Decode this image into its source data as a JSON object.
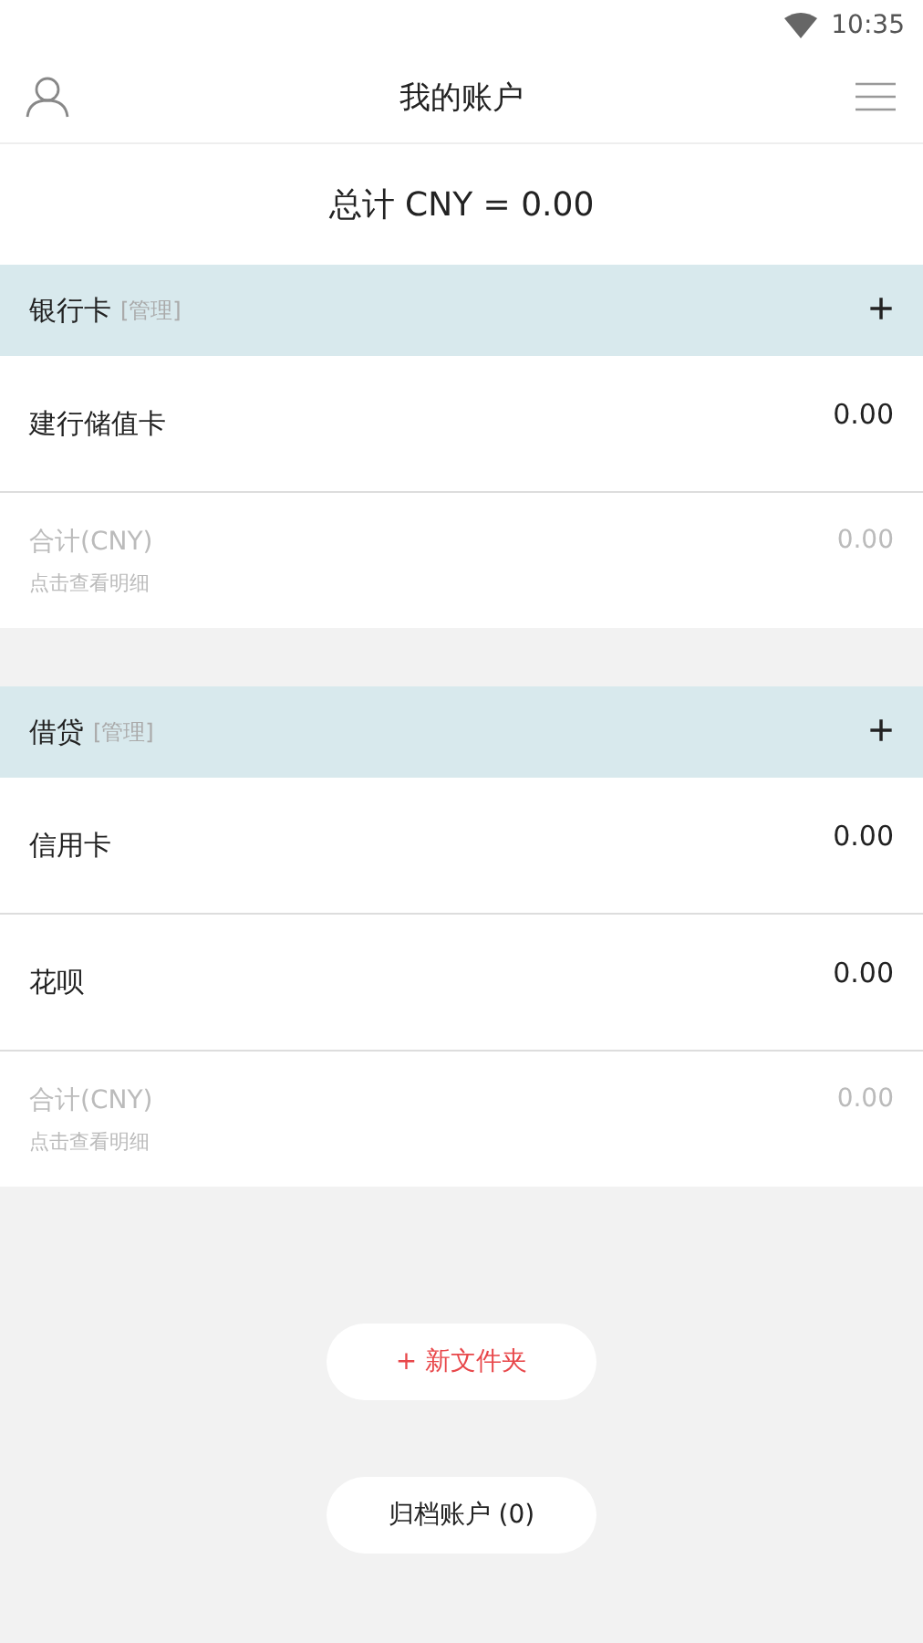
{
  "status_bar": {
    "time": "10:35"
  },
  "header": {
    "title": "我的账户"
  },
  "total": "总计 CNY = 0.00",
  "groups": [
    {
      "title": "银行卡",
      "manage": "[管理]",
      "add": "+",
      "accounts": [
        {
          "name": "建行储值卡",
          "amount": "0.00"
        }
      ],
      "subtotal": {
        "label": "合计(CNY)",
        "amount": "0.00",
        "hint": "点击查看明细"
      }
    },
    {
      "title": "借贷",
      "manage": "[管理]",
      "add": "+",
      "accounts": [
        {
          "name": "信用卡",
          "amount": "0.00"
        },
        {
          "name": "花呗",
          "amount": "0.00"
        }
      ],
      "subtotal": {
        "label": "合计(CNY)",
        "amount": "0.00",
        "hint": "点击查看明细"
      }
    }
  ],
  "buttons": [
    {
      "kind": "accent",
      "label": "+ 新文件夹"
    },
    {
      "kind": "plain",
      "label": "归档账户 (0)"
    }
  ]
}
